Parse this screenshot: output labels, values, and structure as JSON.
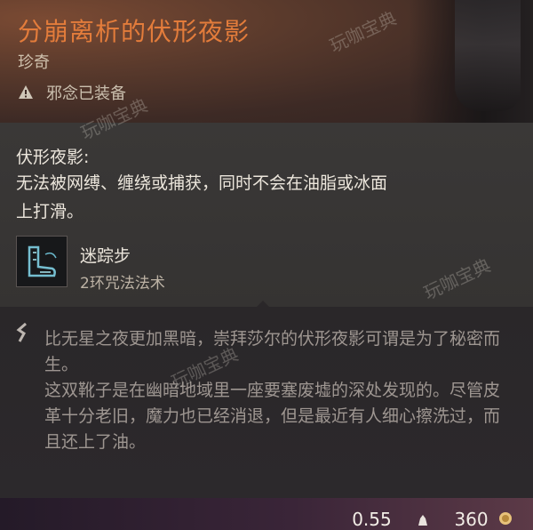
{
  "item": {
    "name": "分崩离析的伏形夜影",
    "rarity": "珍奇",
    "warning": "邪念已装备"
  },
  "effect": {
    "title": "伏形夜影:",
    "description": "无法被网缚、缠绕或捕获，同时不会在油脂或冰面上打滑。",
    "spell": {
      "name": "迷踪步",
      "level": "2环咒法法术"
    }
  },
  "lore": {
    "text1": "比无星之夜更加黑暗，崇拜莎尔的伏形夜影可谓是为了秘密而生。",
    "text2": "这双靴子是在幽暗地域里一座要塞废墟的深处发现的。尽管皮革十分老旧，魔力也已经消退，但是最近有人细心擦洗过，而且还上了油。"
  },
  "footer": {
    "weight": "0.55",
    "value": "360"
  },
  "watermarks": [
    "玩咖宝典",
    "玩咖宝典",
    "玩咖宝典",
    "玩咖宝典"
  ],
  "icons": {
    "warning": "warning-triangle-icon",
    "spell": "misty-step-icon",
    "lore": "lore-chevron-icon",
    "weight": "weight-icon",
    "value": "gold-icon"
  },
  "colors": {
    "name": "#e37c3b",
    "body_text": "#ece6dc",
    "lore_text": "#9e9691"
  }
}
